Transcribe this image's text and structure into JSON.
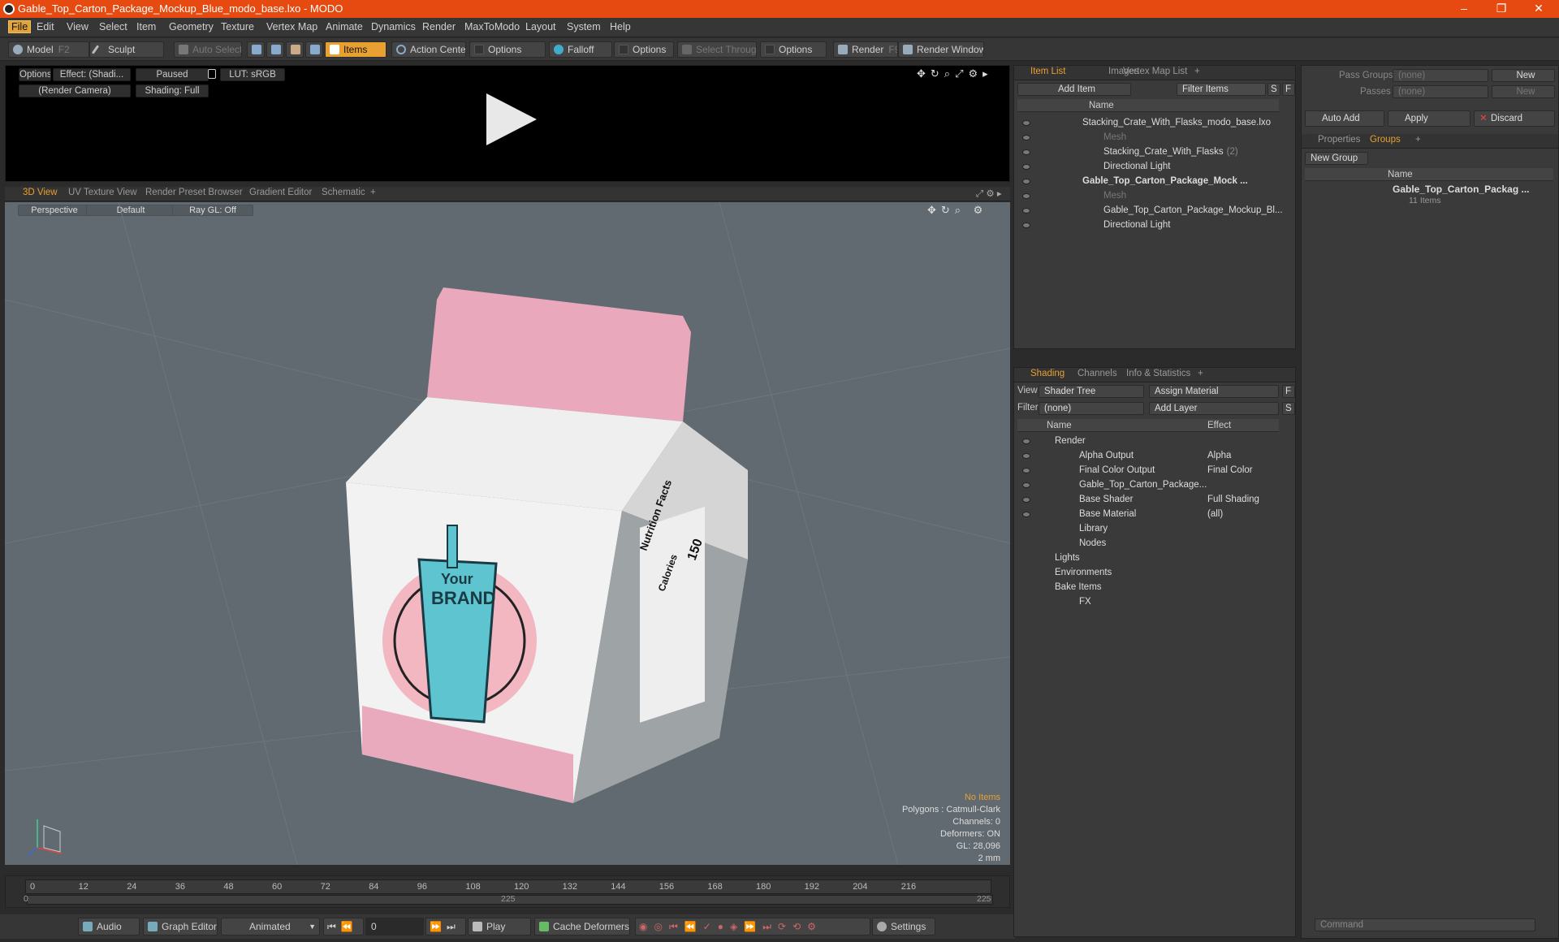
{
  "window": {
    "title": "Gable_Top_Carton_Package_Mockup_Blue_modo_base.lxo - MODO",
    "controls": [
      "–",
      "❐",
      "✕"
    ]
  },
  "menu": [
    "File",
    "Edit",
    "View",
    "Select",
    "Item",
    "Geometry",
    "Texture",
    "Vertex Map",
    "Animate",
    "Dynamics",
    "Render",
    "MaxToModo",
    "Layout",
    "System",
    "Help"
  ],
  "toolbar": {
    "model": "Model",
    "model_key": "F2",
    "sculpt": "Sculpt",
    "auto_select": "Auto Select",
    "items": "Items",
    "action_center": "Action Center",
    "options1": "Options",
    "falloff": "Falloff",
    "options2": "Options",
    "select_through": "Select Through",
    "options3": "Options",
    "render": "Render",
    "render_key": "F9",
    "render_window": "Render Window"
  },
  "render_panel": {
    "options": "Options",
    "effect": "Effect: (Shadi...",
    "paused": "Paused",
    "lut": "LUT: sRGB",
    "camera": "(Render Camera)",
    "shading": "Shading: Full"
  },
  "view_tabs": [
    "3D View",
    "UV Texture View",
    "Render Preset Browser",
    "Gradient Editor",
    "Schematic",
    "+"
  ],
  "viewport": {
    "perspective": "Perspective",
    "default": "Default",
    "raygl": "Ray GL: Off",
    "stats": [
      "No Items",
      "Polygons : Catmull-Clark",
      "Channels: 0",
      "Deformers: ON",
      "GL: 28,096",
      "2 mm"
    ],
    "carton": {
      "brand_line1": "Your",
      "brand_line2": "BRAND",
      "nutrition": "Nutrition Facts",
      "calories": "Calories",
      "cal_value": "150"
    }
  },
  "timeline": {
    "ticks": [
      "0",
      "12",
      "24",
      "36",
      "48",
      "60",
      "72",
      "84",
      "96",
      "108",
      "120",
      "132",
      "144",
      "156",
      "168",
      "180",
      "192",
      "204",
      "216"
    ],
    "sub_left": "0",
    "sub_mid": "225",
    "sub_right": "225"
  },
  "bottombar": {
    "audio": "Audio",
    "graph_editor": "Graph Editor",
    "animated": "Animated",
    "frame": "0",
    "play": "Play",
    "cache": "Cache Deformers",
    "settings": "Settings"
  },
  "item_list": {
    "tabs": [
      "Item List",
      "Images",
      "Vertex Map List",
      "+"
    ],
    "add_item": "Add Item",
    "filter": "Filter Items",
    "s": "S",
    "f": "F",
    "name_col": "Name",
    "rows": [
      {
        "label": "Stacking_Crate_With_Flasks_modo_base.lxo",
        "indent": 0,
        "style": "normal"
      },
      {
        "label": "Mesh",
        "indent": 1,
        "style": "gray"
      },
      {
        "label": "Stacking_Crate_With_Flasks",
        "suffix": "(2)",
        "indent": 1,
        "style": "normal"
      },
      {
        "label": "Directional Light",
        "indent": 1,
        "style": "normal"
      },
      {
        "label": "Gable_Top_Carton_Package_Mock ...",
        "indent": 0,
        "style": "bold"
      },
      {
        "label": "Mesh",
        "indent": 1,
        "style": "gray"
      },
      {
        "label": "Gable_Top_Carton_Package_Mockup_Bl...",
        "indent": 1,
        "style": "normal"
      },
      {
        "label": "Directional Light",
        "indent": 1,
        "style": "normal"
      }
    ]
  },
  "shading": {
    "tabs": [
      "Shading",
      "Channels",
      "Info & Statistics",
      "+"
    ],
    "view_label": "View",
    "view_value": "Shader Tree",
    "assign": "Assign Material",
    "f": "F",
    "filter_label": "Filter",
    "filter_value": "(none)",
    "add_layer": "Add Layer",
    "s": "S",
    "name_col": "Name",
    "effect_col": "Effect",
    "rows": [
      {
        "label": "Render",
        "effect": "",
        "indent": 0
      },
      {
        "label": "Alpha Output",
        "effect": "Alpha",
        "indent": 1
      },
      {
        "label": "Final Color Output",
        "effect": "Final Color",
        "indent": 1
      },
      {
        "label": "Gable_Top_Carton_Package...",
        "effect": "",
        "indent": 1
      },
      {
        "label": "Base Shader",
        "effect": "Full Shading",
        "indent": 1
      },
      {
        "label": "Base Material",
        "effect": "(all)",
        "indent": 1
      },
      {
        "label": "Library",
        "effect": "",
        "indent": 1
      },
      {
        "label": "Nodes",
        "effect": "",
        "indent": 1
      },
      {
        "label": "Lights",
        "effect": "",
        "indent": 0
      },
      {
        "label": "Environments",
        "effect": "",
        "indent": 0
      },
      {
        "label": "Bake Items",
        "effect": "",
        "indent": 0
      },
      {
        "label": "FX",
        "effect": "",
        "indent": 1
      }
    ]
  },
  "right_panel": {
    "pass_groups": "Pass Groups",
    "pass_groups_value": "(none)",
    "new": "New",
    "passes": "Passes",
    "passes_value": "(none)",
    "new2": "New",
    "auto_add": "Auto Add",
    "apply": "Apply",
    "discard": "Discard",
    "tabs": [
      "Properties",
      "Groups",
      "+"
    ],
    "new_group": "New Group",
    "name_col": "Name",
    "group_name": "Gable_Top_Carton_Packag ...",
    "group_count": "11 Items",
    "command": "Command"
  },
  "colors": {
    "accent": "#e8a030",
    "title": "#e64a10"
  }
}
